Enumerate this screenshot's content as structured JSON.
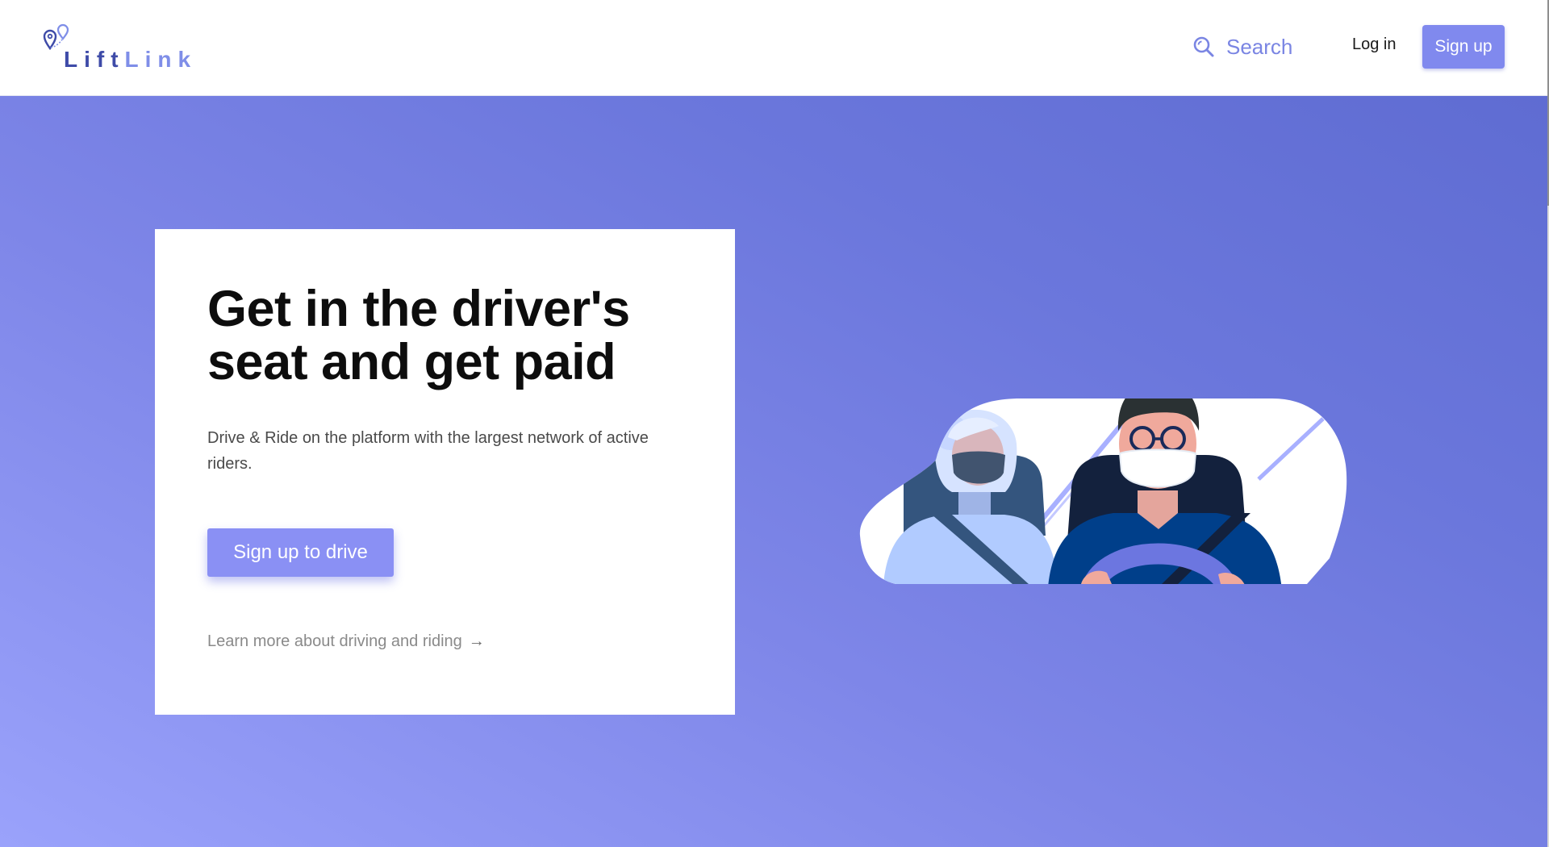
{
  "header": {
    "logo_text": "LiftLink",
    "logo_text_primary": "Lift",
    "logo_text_secondary": "Link",
    "search_label": "Search",
    "login_label": "Log in",
    "signup_label": "Sign up"
  },
  "hero": {
    "title": "Get in the driver's seat and get paid",
    "subtitle": "Drive & Ride on the platform with the largest network of active riders.",
    "cta_label": "Sign up to drive",
    "learn_more_label": "Learn more about driving and riding",
    "learn_more_arrow": "→"
  },
  "colors": {
    "brand": "#8089ee",
    "brand_dark": "#3e4ba8",
    "hero_gradient_start": "#9aa2fb",
    "hero_gradient_end": "#5f6cd2",
    "card_bg": "#ffffff"
  },
  "icons": {
    "logo": "map-pin-pair-icon",
    "search": "search-icon",
    "arrow": "arrow-right-icon"
  }
}
